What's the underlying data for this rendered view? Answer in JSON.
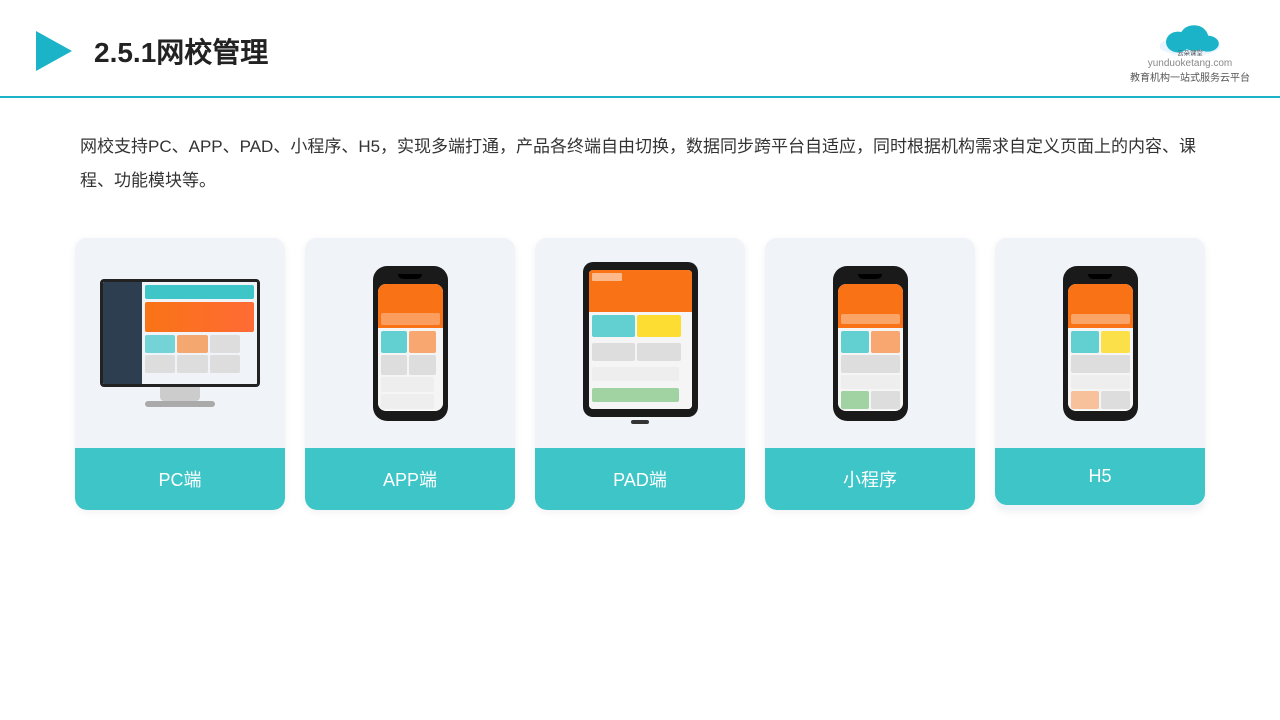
{
  "header": {
    "title": "2.5.1网校管理",
    "logo_url": "yunduoketang.com",
    "logo_slogan": "教育机构一站\n式服务云平台"
  },
  "description": {
    "text": "网校支持PC、APP、PAD、小程序、H5，实现多端打通，产品各终端自由切换，数据同步跨平台自适应，同时根据机构需求自定义页面上的内容、课程、功能模块等。"
  },
  "cards": [
    {
      "id": "pc",
      "label": "PC端"
    },
    {
      "id": "app",
      "label": "APP端"
    },
    {
      "id": "pad",
      "label": "PAD端"
    },
    {
      "id": "miniprogram",
      "label": "小程序"
    },
    {
      "id": "h5",
      "label": "H5"
    }
  ],
  "colors": {
    "teal": "#3dc5c8",
    "accent_blue": "#1ab3c8",
    "orange": "#f97316"
  }
}
